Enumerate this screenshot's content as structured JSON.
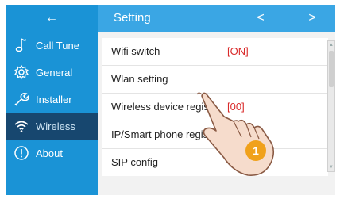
{
  "header": {
    "back_symbol": "←",
    "title": "Setting",
    "prev_symbol": "<",
    "next_symbol": ">"
  },
  "sidebar": {
    "items": [
      {
        "label": "Call Tune",
        "icon": "music-note-icon"
      },
      {
        "label": "General",
        "icon": "gear-icon"
      },
      {
        "label": "Installer",
        "icon": "wrench-icon"
      },
      {
        "label": "Wireless",
        "icon": "wifi-icon",
        "active": true
      },
      {
        "label": "About",
        "icon": "info-icon"
      }
    ]
  },
  "settings": {
    "rows": [
      {
        "label": "Wifi switch",
        "value": "[ON]"
      },
      {
        "label": "Wlan setting",
        "value": ""
      },
      {
        "label": "Wireless device regist",
        "value": "[00]"
      },
      {
        "label": "IP/Smart phone regist",
        "value": ""
      },
      {
        "label": "SIP config",
        "value": ""
      }
    ]
  },
  "annotation": {
    "step_number": "1"
  },
  "colors": {
    "sidebar_bg": "#1a93d6",
    "sidebar_active_bg": "#17476f",
    "header_bg": "#3aa6e4",
    "value_red": "#d92a2a",
    "badge_orange": "#f0a11b"
  }
}
